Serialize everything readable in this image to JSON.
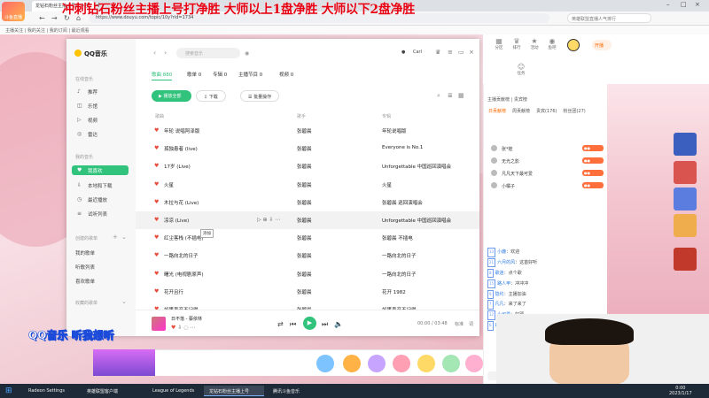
{
  "browser": {
    "tab_title": "龙钻石粉丝主播上号打净胜",
    "url": "https://www.douyu.com/topic/10y?rid=1734",
    "ext_search_placeholder": "英雄联盟直播人气排行",
    "bookmarks": "主播关注 | 我的关注 | 我的订阅 | 最近观看"
  },
  "overlay": {
    "title": "冲刺钻石粉丝主播上号打净胜 大师以上1盘净胜 大师以下2盘净胜",
    "live_logo": "斗鱼直播",
    "banner": "QQ音乐 听我想听"
  },
  "qq": {
    "app_name": "QQ音乐",
    "search_placeholder": "搜索音乐",
    "user": "Carl",
    "sidebar": {
      "online_music_label": "在线音乐",
      "my_music_label": "我的音乐",
      "created_playlists_label": "创建的歌单",
      "collected_playlists_label": "收藏的歌单",
      "online": [
        {
          "label": "推荐",
          "icon": "recommend-icon"
        },
        {
          "label": "乐馆",
          "icon": "hall-icon"
        },
        {
          "label": "视频",
          "icon": "video-icon"
        },
        {
          "label": "雷达",
          "icon": "radar-icon"
        }
      ],
      "mine": [
        {
          "label": "我喜欢",
          "icon": "heart-icon"
        },
        {
          "label": "本地和下载",
          "icon": "download-icon"
        },
        {
          "label": "最近播放",
          "icon": "history-icon"
        },
        {
          "label": "试听列表",
          "icon": "list-icon"
        }
      ],
      "created": [
        "我的歌单",
        "听歌列表",
        "喜欢歌单"
      ]
    },
    "tabs": [
      "歌曲 880",
      "歌单 0",
      "专辑 0",
      "主播节目 0",
      "视频 0"
    ],
    "actions": {
      "play_all": "播放全部",
      "download": "下载",
      "batch": "批量操作"
    },
    "columns": {
      "title": "歌曲",
      "artist": "歌手",
      "album": "专辑"
    },
    "songs": [
      {
        "title": "年轮 说唱阿泽版",
        "artist": "张碧晨",
        "album": "年轮说唱版"
      },
      {
        "title": "孤独患者 (live)",
        "artist": "张碧晨",
        "album": "Everyone is No.1"
      },
      {
        "title": "17岁 (Live)",
        "artist": "张碧晨",
        "album": "Unforgettable 中国巡回演唱会"
      },
      {
        "title": "火星",
        "artist": "张碧晨",
        "album": "火星"
      },
      {
        "title": "木拉与花  (Live)",
        "artist": "张碧晨",
        "album": "张碧晨 巡回演唱会"
      },
      {
        "title": "凉凉 (Live)",
        "artist": "张碧晨",
        "album": "Unforgettable 中国巡回演唱会"
      },
      {
        "title": "红尘客栈 (不插电)",
        "artist": "张碧晨",
        "album": "张碧晨 不插电"
      },
      {
        "title": "一路向北的日子",
        "artist": "张碧晨",
        "album": "一路向北的日子"
      },
      {
        "title": "曙光 (电视剧原声)",
        "artist": "张碧晨",
        "album": "一路向北的日子"
      },
      {
        "title": "花开且行",
        "artist": "张碧晨",
        "album": "花开 1982"
      },
      {
        "title": "如果声音不记得",
        "artist": "张碧晨",
        "album": "如果声音不记得"
      }
    ],
    "hover_tooltip": "添加",
    "player": {
      "now_playing": "日不落 - 蔡依林",
      "time": "00:00 / 03:48",
      "quality": "标准",
      "lyric": "词"
    }
  },
  "right": {
    "top_icons": [
      "分区",
      "排行",
      "活动",
      "鱼吧",
      "任务"
    ],
    "open_label": "开播",
    "chat_header": "主播贡献榜 | 贵宾榜",
    "chat_tabs": [
      "日贡献榜",
      "周贡献榜",
      "贵宾(176)",
      "粉丝团(27)"
    ],
    "ranks": [
      "张*娃",
      "无光之影",
      "凡凡天下最可爱",
      "小橘子"
    ],
    "messages": [
      {
        "lv": "13",
        "name": "小鹿",
        "text": "欢迎"
      },
      {
        "lv": "21",
        "name": "六月的风",
        "text": "这首好听"
      },
      {
        "lv": "8",
        "name": "歌迷",
        "text": "点个歌"
      },
      {
        "lv": "15",
        "name": "路人甲",
        "text": "冲冲冲"
      },
      {
        "lv": "9",
        "name": "隐约",
        "text": "主播加油"
      },
      {
        "lv": "7",
        "name": "凡凡",
        "text": "来了来了"
      },
      {
        "lv": "12",
        "name": "小可爱",
        "text": "好耶"
      },
      {
        "lv": "6",
        "name": "Laoz",
        "text": "666"
      }
    ]
  },
  "taskbar": {
    "apps": [
      "Radeon Settings",
      "英雄联盟客户端",
      "League of Legends",
      "龙钻石粉丝主播上号",
      "腾讯斗鱼音乐"
    ],
    "time": "0:00",
    "date": "2023/1/17"
  }
}
